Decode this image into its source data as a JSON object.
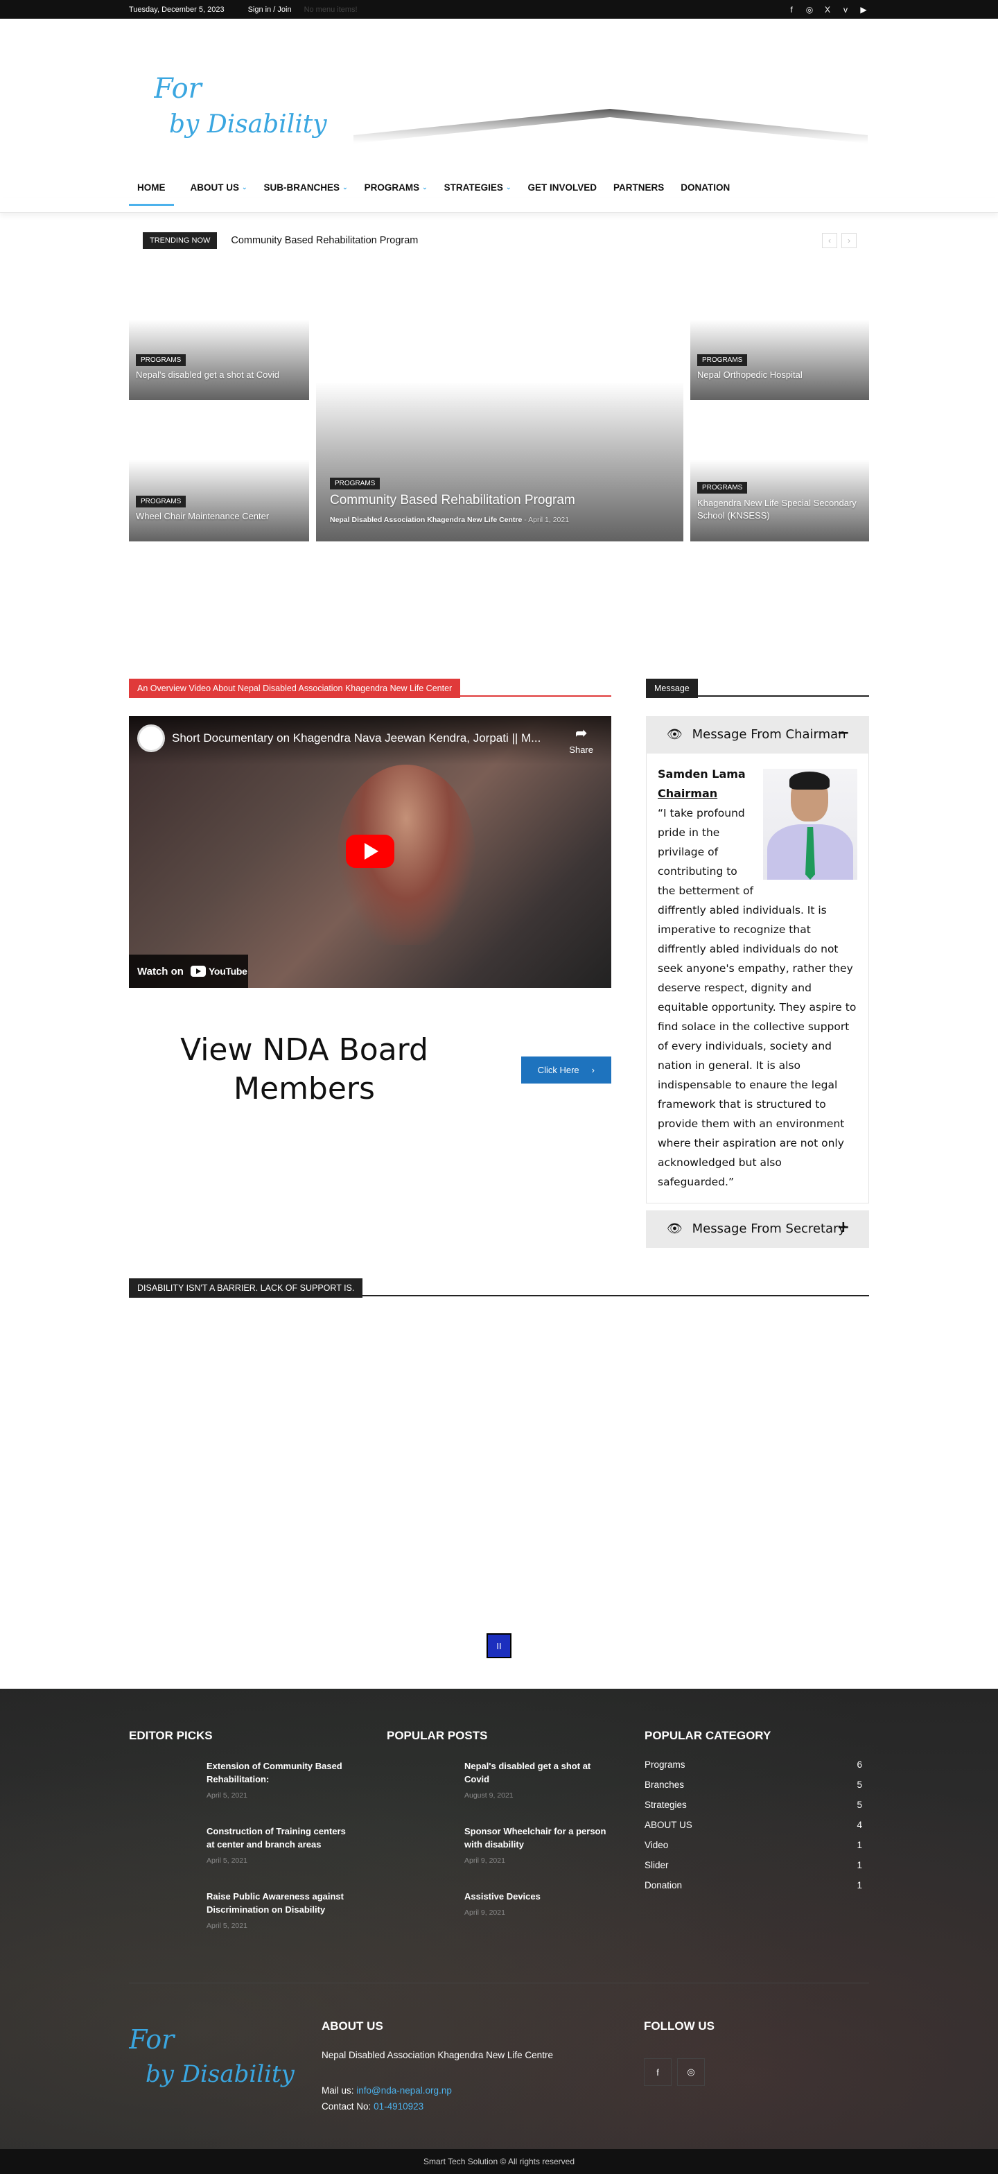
{
  "topbar": {
    "date": "Tuesday, December 5, 2023",
    "signin": "Sign in / Join",
    "no_menu": "No menu items!",
    "social": [
      "f",
      "◎",
      "X",
      "v",
      "▶"
    ]
  },
  "logo": {
    "line1": "For",
    "line2": "by Disability"
  },
  "nav": {
    "items": [
      {
        "label": "HOME",
        "dropdown": false
      },
      {
        "label": "ABOUT US",
        "dropdown": true
      },
      {
        "label": "SUB-BRANCHES",
        "dropdown": true
      },
      {
        "label": "PROGRAMS",
        "dropdown": true
      },
      {
        "label": "STRATEGIES",
        "dropdown": true
      },
      {
        "label": "GET INVOLVED",
        "dropdown": false
      },
      {
        "label": "PARTNERS",
        "dropdown": false
      },
      {
        "label": "DONATION",
        "dropdown": false
      }
    ]
  },
  "trending": {
    "label": "TRENDING NOW",
    "text": "Community Based Rehabilitation Program",
    "prev": "‹",
    "next": "›"
  },
  "hero": {
    "tiles": [
      {
        "category": "PROGRAMS",
        "title": "Nepal's disabled get a shot at Covid"
      },
      {
        "category": "PROGRAMS",
        "title": "Community Based Rehabilitation Program",
        "author": "Nepal Disabled Association Khagendra New Life Centre",
        "separator": "-",
        "date": "April 1, 2021"
      },
      {
        "category": "PROGRAMS",
        "title": "Nepal Orthopedic Hospital"
      },
      {
        "category": "PROGRAMS",
        "title": "Wheel Chair Maintenance Center"
      },
      {
        "category": "PROGRAMS",
        "title": "Khagendra New Life Special Secondary School (KNSESS)"
      }
    ]
  },
  "video_section": {
    "title": "An Overview Video About Nepal Disabled Association Khagendra New Life Center",
    "video_title": "Short Documentary on Khagendra Nava Jeewan Kendra, Jorpati || M...",
    "share": "Share",
    "watch_on": "Watch on",
    "youtube": "YouTube"
  },
  "board": {
    "title": "View NDA Board Members",
    "button": "Click Here",
    "button_icon": "›"
  },
  "message": {
    "title": "Message",
    "chairman_heading": "Message From Chairman",
    "chairman_toggle": "−",
    "name": "Samden Lama",
    "role": "Chairman",
    "text": "“I take profound pride in the privilage of contributing to the betterment of diffrently abled individuals. It is imperative to recognize that diffrently abled individuals do not seek anyone's empathy, rather they deserve respect, dignity and equitable opportunity. They aspire to find solace in the collective support of every individuals, society and nation in general. It is also indispensable to enaure the legal framework that is structured to provide them with an environment where their aspiration are not only acknowledged but also safeguarded.”",
    "secretary_heading": "Message From Secretary",
    "secretary_toggle": "+"
  },
  "barrier": {
    "title": "DISABILITY ISN'T A BARRIER. LACK OF SUPPORT IS.",
    "pager": "II"
  },
  "footer": {
    "editor_picks": {
      "title": "EDITOR PICKS",
      "posts": [
        {
          "title": "Extension of Community Based Rehabilitation:",
          "date": "April 5, 2021"
        },
        {
          "title": "Construction of Training centers at center and branch areas",
          "date": "April 5, 2021"
        },
        {
          "title": "Raise Public Awareness against Discrimination on Disability",
          "date": "April 5, 2021"
        }
      ]
    },
    "popular_posts": {
      "title": "POPULAR POSTS",
      "posts": [
        {
          "title": "Nepal's disabled get a shot at Covid",
          "date": "August 9, 2021"
        },
        {
          "title": "Sponsor Wheelchair for a person with disability",
          "date": "April 9, 2021"
        },
        {
          "title": "Assistive Devices",
          "date": "April 9, 2021"
        }
      ]
    },
    "popular_category": {
      "title": "POPULAR CATEGORY",
      "items": [
        {
          "name": "Programs",
          "count": "6"
        },
        {
          "name": "Branches",
          "count": "5"
        },
        {
          "name": "Strategies",
          "count": "5"
        },
        {
          "name": "ABOUT US",
          "count": "4"
        },
        {
          "name": "Video",
          "count": "1"
        },
        {
          "name": "Slider",
          "count": "1"
        },
        {
          "name": "Donation",
          "count": "1"
        }
      ]
    },
    "about": {
      "title": "ABOUT US",
      "text": "Nepal Disabled Association Khagendra New Life Centre",
      "mail_label": "Mail us:",
      "mail": "info@nda-nepal.org.np",
      "contact_label": "Contact No:",
      "contact": "01-4910923"
    },
    "follow": {
      "title": "FOLLOW US",
      "icons": [
        "f",
        "◎"
      ]
    },
    "copyright": "Smart Tech Solution © All rights reserved"
  }
}
